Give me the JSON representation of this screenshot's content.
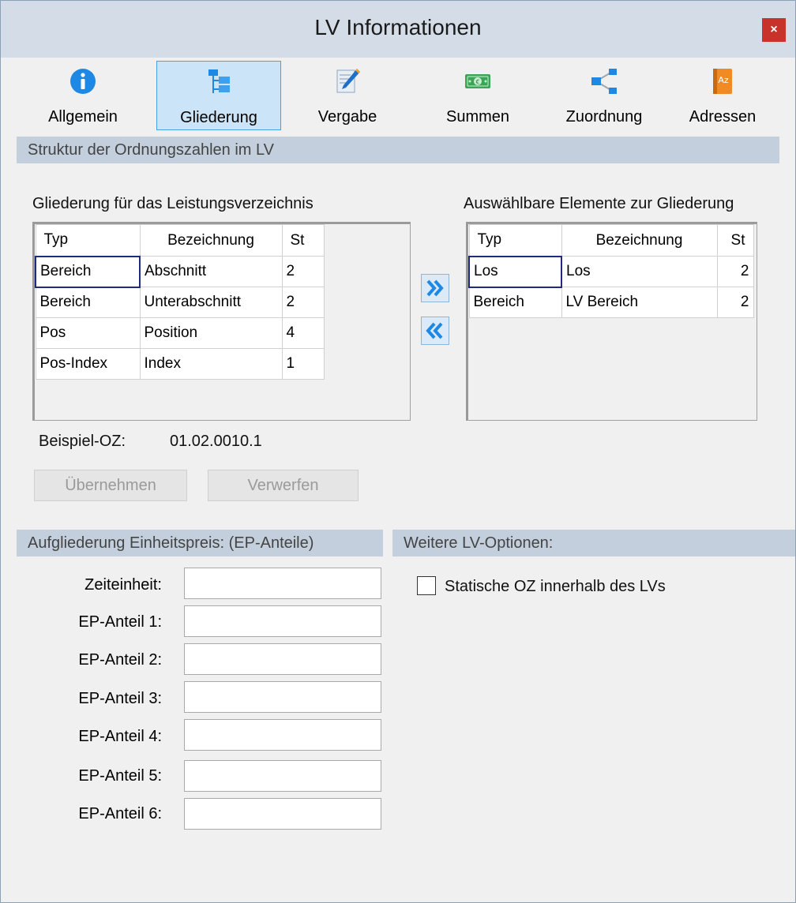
{
  "window": {
    "title": "LV Informationen",
    "close_label": "×"
  },
  "toolbar": {
    "items": [
      {
        "label": "Allgemein",
        "icon": "info-icon"
      },
      {
        "label": "Gliederung",
        "icon": "tree-structure-icon",
        "active": true
      },
      {
        "label": "Vergabe",
        "icon": "edit-document-icon"
      },
      {
        "label": "Summen",
        "icon": "money-icon"
      },
      {
        "label": "Zuordnung",
        "icon": "share-nodes-icon"
      },
      {
        "label": "Adressen",
        "icon": "address-book-icon"
      }
    ]
  },
  "structure": {
    "section_title": "Struktur der Ordnungszahlen im LV",
    "left_title": "Gliederung für das Leistungsverzeichnis",
    "right_title": "Auswählbare Elemente zur Gliederung",
    "columns": [
      "Typ",
      "Bezeichnung",
      "St"
    ],
    "left_rows": [
      [
        "Bereich",
        "Abschnitt",
        "2"
      ],
      [
        "Bereich",
        "Unterabschnitt",
        "2"
      ],
      [
        "Pos",
        "Position",
        "4"
      ],
      [
        "Pos-Index",
        "Index",
        "1"
      ]
    ],
    "right_rows": [
      [
        "Los",
        "Los",
        "2"
      ],
      [
        "Bereich",
        "LV Bereich",
        "2"
      ]
    ],
    "move_right_label": "»",
    "move_left_label": "«",
    "example_label": "Beispiel-OZ:",
    "example_value": "01.02.0010.1",
    "apply_label": "Übernehmen",
    "discard_label": "Verwerfen"
  },
  "ep": {
    "section_title": "Aufgliederung Einheitspreis: (EP-Anteile)",
    "fields": [
      {
        "label": "Zeiteinheit:",
        "value": ""
      },
      {
        "label": "EP-Anteil 1:",
        "value": ""
      },
      {
        "label": "EP-Anteil 2:",
        "value": ""
      },
      {
        "label": "EP-Anteil 3:",
        "value": ""
      },
      {
        "label": "EP-Anteil 4:",
        "value": ""
      },
      {
        "label": "EP-Anteil 5:",
        "value": ""
      },
      {
        "label": "EP-Anteil 6:",
        "value": ""
      }
    ]
  },
  "options": {
    "section_title": "Weitere LV-Optionen:",
    "static_oz_label": "Statische OZ innerhalb des LVs",
    "static_oz_checked": false
  },
  "colors": {
    "accent": "#4da0e0",
    "section_bar": "#c3cfdc",
    "close": "#c7322b",
    "arrow": "#1e88e5"
  }
}
